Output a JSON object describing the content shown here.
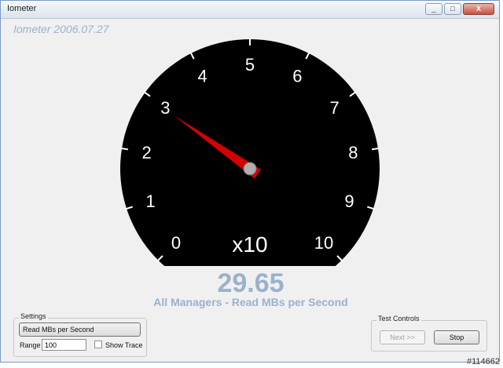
{
  "window": {
    "title": "Iometer",
    "minimize_label": "_",
    "maximize_label": "□",
    "close_label": "X"
  },
  "version_label": "Iometer 2006.07.27",
  "gauge": {
    "ticks": [
      "0",
      "1",
      "2",
      "3",
      "4",
      "5",
      "6",
      "7",
      "8",
      "9",
      "10"
    ],
    "multiplier": "x10",
    "needle_value": 29.65,
    "scale_max": 100,
    "face_color": "#000000",
    "needle_color": "#d40000"
  },
  "reading": {
    "value": "29.65",
    "label": "All Managers - Read MBs per Second",
    "color": "#9bb1cd"
  },
  "settings": {
    "group_title": "Settings",
    "metric_button": "Read MBs per Second",
    "range_label": "Range",
    "range_value": "100",
    "show_trace_label": "Show Trace",
    "show_trace_checked": false
  },
  "test_controls": {
    "group_title": "Test Controls",
    "next_label": "Next >>",
    "stop_label": "Stop"
  },
  "watermark": "#114662"
}
